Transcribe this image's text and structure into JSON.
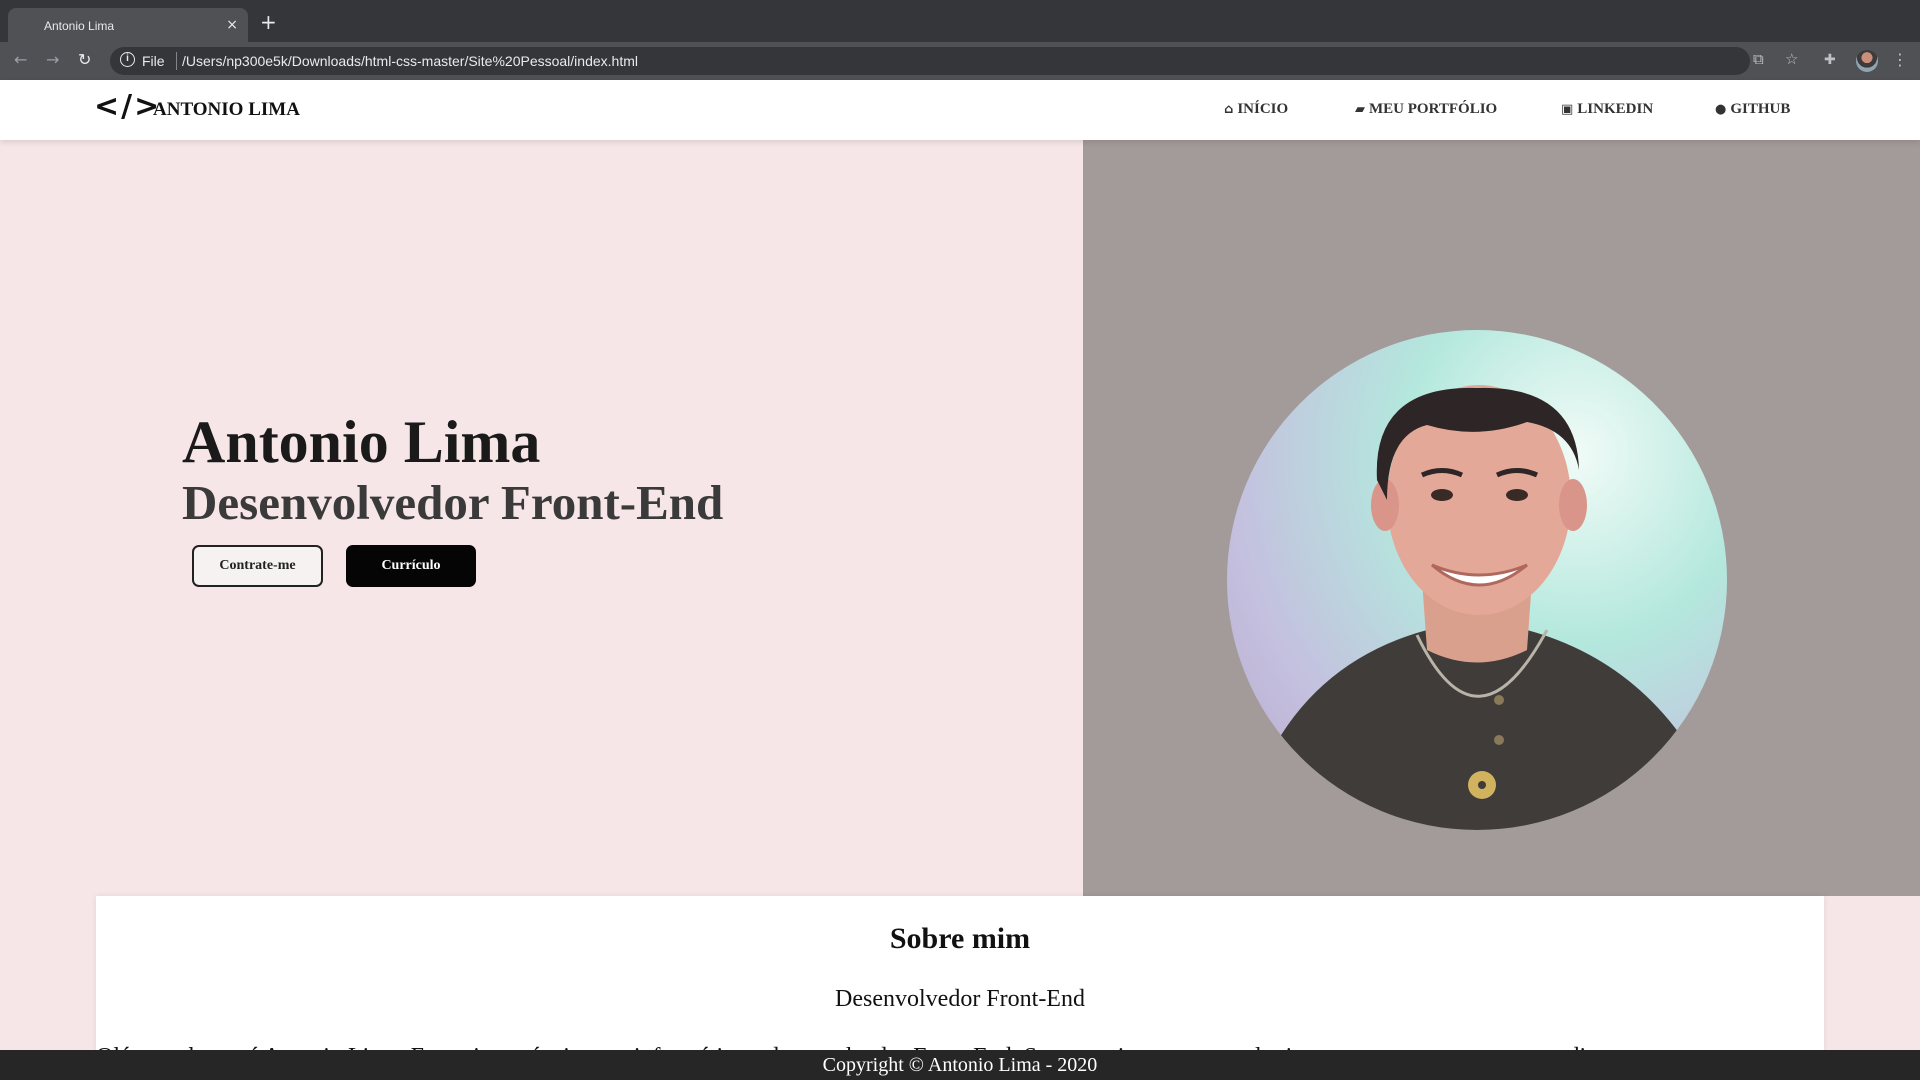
{
  "browser": {
    "tab_title": "Antonio Lima",
    "tab_close": "×",
    "new_tab": "+",
    "scheme_label": "File",
    "url": "/Users/np300e5k/Downloads/html-css-master/Site%20Pessoal/index.html",
    "icons": [
      "back-icon",
      "forward-icon",
      "reload-icon",
      "site-info-icon",
      "translate-icon",
      "bookmark-star-icon",
      "extensions-icon",
      "profile-avatar",
      "menu-kebab-icon"
    ]
  },
  "header": {
    "logo_icon": "</>",
    "logo_text": "ANTONIO LIMA",
    "nav": [
      {
        "icon": "home-icon",
        "label": "INÍCIO"
      },
      {
        "icon": "briefcase-icon",
        "label": "MEU PORTFÓLIO"
      },
      {
        "icon": "linkedin-icon",
        "label": "LINKEDIN"
      },
      {
        "icon": "github-icon",
        "label": "GITHUB"
      }
    ]
  },
  "hero": {
    "name": "Antonio Lima",
    "role": "Desenvolvedor Front-End",
    "hire_button": "Contrate-me",
    "resume_button": "Currículo",
    "photo": "profile-photo"
  },
  "about": {
    "title": "Sobre mim",
    "subtitle": "Desenvolvedor Front-End",
    "text": "Olá, me chamo é Antonio Lima. Formei-me técnico em informática e desenvolvedor Front-End. Sou entusiasta em tecnologia e estou em constante aprendizagem."
  },
  "footer": {
    "copyright": "Copyright © Antonio Lima - 2020"
  },
  "colors": {
    "hero_left_bg": "#f6e6e7",
    "hero_right_bg": "#a39a9a",
    "footer_bg": "#262626",
    "primary_button": "#050505"
  }
}
